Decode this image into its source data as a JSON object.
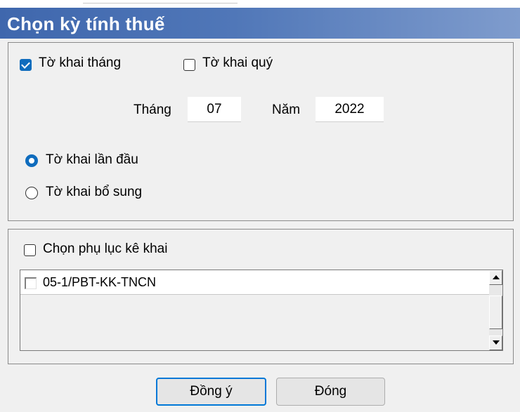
{
  "window": {
    "title": "Chọn kỳ tính thuế"
  },
  "period": {
    "monthly_label": "Tờ khai tháng",
    "monthly_checked": true,
    "quarterly_label": "Tờ khai quý",
    "quarterly_checked": false,
    "month_label": "Tháng",
    "month_value": "07",
    "year_label": "Năm",
    "year_value": "2022",
    "filing_type": {
      "options": [
        "Tờ khai lần đầu",
        "Tờ khai bổ sung"
      ],
      "selected": "Tờ khai lần đầu"
    }
  },
  "appendix": {
    "select_label": "Chọn phụ lục kê khai",
    "select_checked": false,
    "items": [
      {
        "label": "05-1/PBT-KK-TNCN",
        "checked": false
      }
    ]
  },
  "buttons": {
    "ok_label": "Đồng ý",
    "close_label": "Đóng"
  },
  "icons": {
    "scroll_up": "arrow-up-icon",
    "scroll_down": "arrow-down-icon"
  },
  "colors": {
    "titlebar": "#4a70b5",
    "accent": "#0f6cbd",
    "default_button_border": "#0078d7"
  }
}
